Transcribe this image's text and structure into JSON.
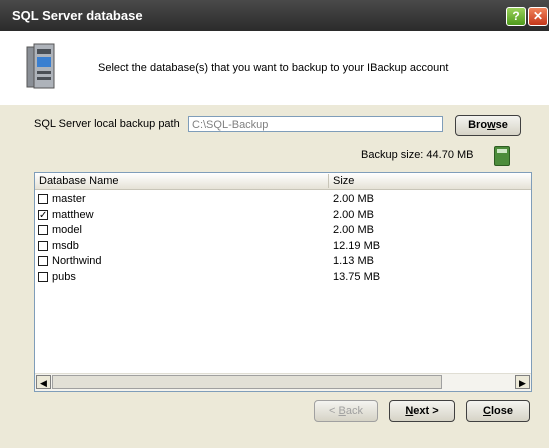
{
  "window": {
    "title": "SQL Server database",
    "help_label": "?",
    "close_label": "✕"
  },
  "header": {
    "instruction": "Select the database(s) that you want to backup to your IBackup account"
  },
  "backup_path": {
    "label": "SQL Server local backup path",
    "value": "C:\\SQL-Backup",
    "browse_label_pre": "Bro",
    "browse_label_u": "w",
    "browse_label_post": "se"
  },
  "backup_size": {
    "label": "Backup size: 44.70 MB"
  },
  "table": {
    "col_name": "Database Name",
    "col_size": "Size",
    "rows": [
      {
        "name": "master",
        "size": "2.00 MB",
        "checked": false
      },
      {
        "name": "matthew",
        "size": "2.00 MB",
        "checked": true
      },
      {
        "name": "model",
        "size": "2.00 MB",
        "checked": false
      },
      {
        "name": "msdb",
        "size": "12.19 MB",
        "checked": false
      },
      {
        "name": "Northwind",
        "size": "1.13 MB",
        "checked": false
      },
      {
        "name": "pubs",
        "size": "13.75 MB",
        "checked": false
      }
    ]
  },
  "buttons": {
    "back_pre": "< ",
    "back_u": "B",
    "back_post": "ack",
    "next_u": "N",
    "next_post": "ext >",
    "close_u": "C",
    "close_post": "lose"
  },
  "colors": {
    "titlebar": "#2b2b2b",
    "background": "#ece9d8",
    "accent": "#4c8c3b"
  },
  "icons": {
    "header": "server-tower-icon",
    "size": "calculator-icon"
  }
}
